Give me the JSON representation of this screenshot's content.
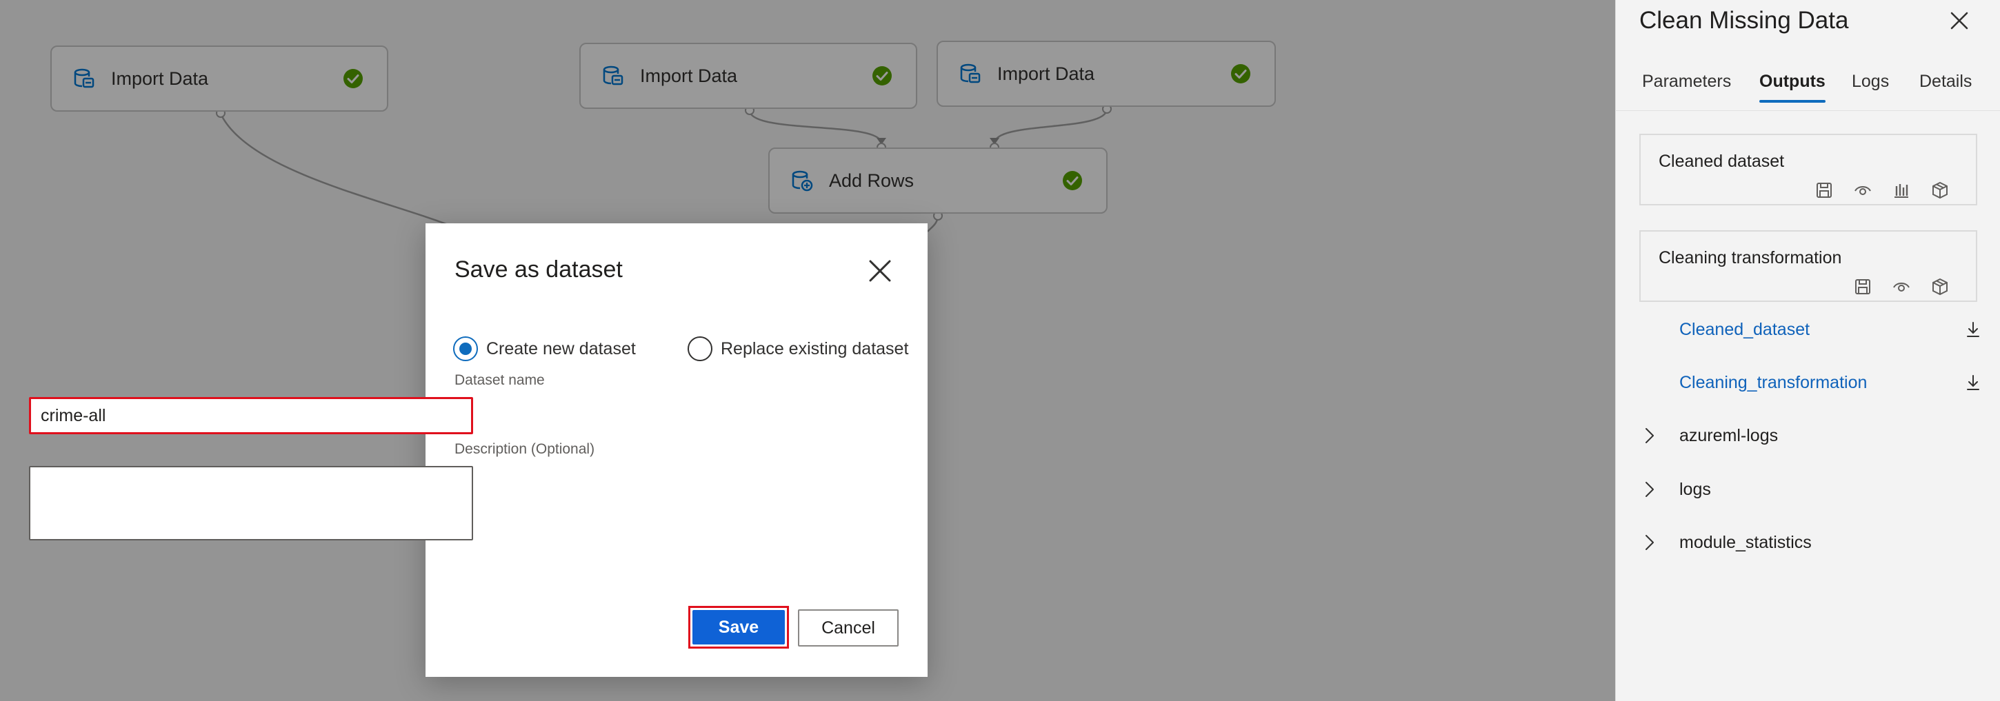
{
  "canvas": {
    "nodes": [
      {
        "label": "Import Data",
        "status": "completed"
      },
      {
        "label": "Import Data",
        "status": "completed"
      },
      {
        "label": "Import Data",
        "status": "completed"
      },
      {
        "label": "Add Rows",
        "status": "completed"
      }
    ],
    "status_color": "#57a300",
    "icon_color": "#0078d4"
  },
  "dialog": {
    "title": "Save as dataset",
    "radio_options": [
      {
        "label": "Create new dataset",
        "selected": true
      },
      {
        "label": "Replace existing dataset",
        "selected": false
      }
    ],
    "name_label": "Dataset name",
    "name_value": "crime-all",
    "description_label": "Description (Optional)",
    "description_value": "",
    "save_label": "Save",
    "cancel_label": "Cancel",
    "primary_color": "#0f62d6",
    "highlight_color": "#e0101d"
  },
  "panel": {
    "title": "Clean Missing Data",
    "tabs": [
      {
        "label": "Parameters",
        "active": false
      },
      {
        "label": "Outputs",
        "active": true
      },
      {
        "label": "Logs",
        "active": false
      },
      {
        "label": "Details",
        "active": false
      }
    ],
    "output_cards": [
      {
        "title": "Cleaned dataset",
        "actions": [
          "save-icon",
          "eye-icon",
          "bar-chart-icon",
          "cube-icon"
        ]
      },
      {
        "title": "Cleaning transformation",
        "actions": [
          "save-icon",
          "eye-icon",
          "cube-icon"
        ]
      }
    ],
    "files": [
      {
        "name": "Cleaned_dataset"
      },
      {
        "name": "Cleaning_transformation"
      }
    ],
    "folders": [
      {
        "name": "azureml-logs"
      },
      {
        "name": "logs"
      },
      {
        "name": "module_statistics"
      }
    ],
    "accent_color": "#0f6cbd",
    "link_color": "#0f62ba"
  }
}
